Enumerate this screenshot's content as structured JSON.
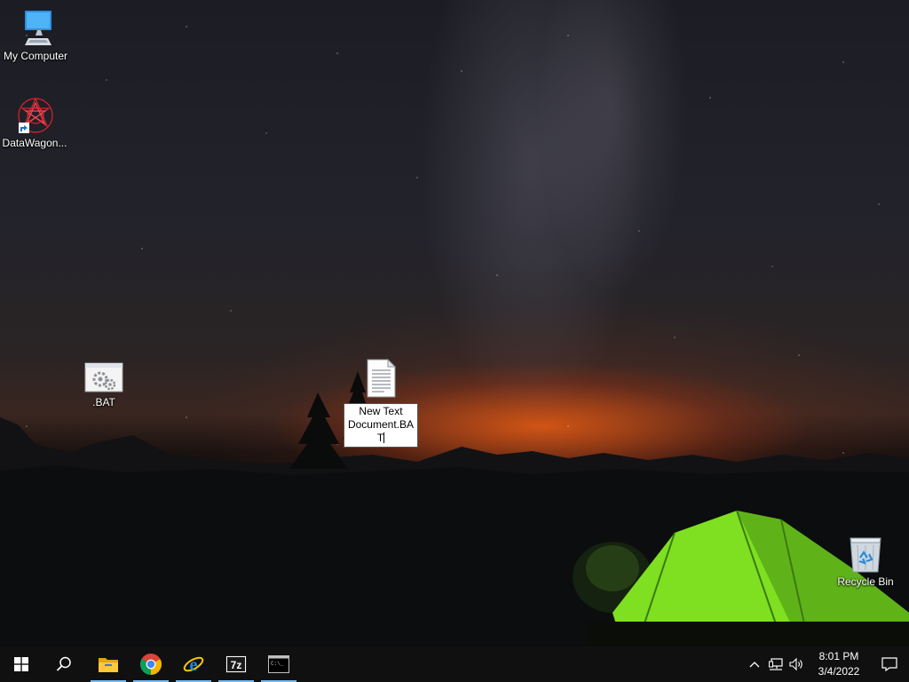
{
  "desktop": {
    "icons": [
      {
        "label": "My Computer",
        "icon": "computer-icon"
      },
      {
        "label": "DataWagon...",
        "icon": "datawagon-icon"
      },
      {
        "label": ".BAT",
        "icon": "batch-file-icon"
      },
      {
        "label": "Recycle Bin",
        "icon": "recycle-bin-icon"
      }
    ],
    "renaming": {
      "icon": "text-document-icon",
      "value_line1": "New Text",
      "value_line2": "Document.BA",
      "value_line3": "T"
    }
  },
  "taskbar": {
    "buttons": [
      {
        "name": "start",
        "icon": "windows-start-icon",
        "running": false
      },
      {
        "name": "search",
        "icon": "search-icon",
        "running": false
      },
      {
        "name": "file-explorer",
        "icon": "folder-icon",
        "running": true
      },
      {
        "name": "chrome",
        "icon": "chrome-icon",
        "running": true
      },
      {
        "name": "internet-explorer",
        "icon": "ie-icon",
        "running": true
      },
      {
        "name": "7zip",
        "icon": "7zip-icon",
        "running": true
      },
      {
        "name": "command-prompt",
        "icon": "cmd-icon",
        "running": true
      }
    ],
    "tray": {
      "time": "8:01 PM",
      "date": "3/4/2022"
    }
  },
  "colors": {
    "taskbar_bg": "#101010",
    "running_indicator": "#76b9ed",
    "tent_green": "#7ee020"
  }
}
